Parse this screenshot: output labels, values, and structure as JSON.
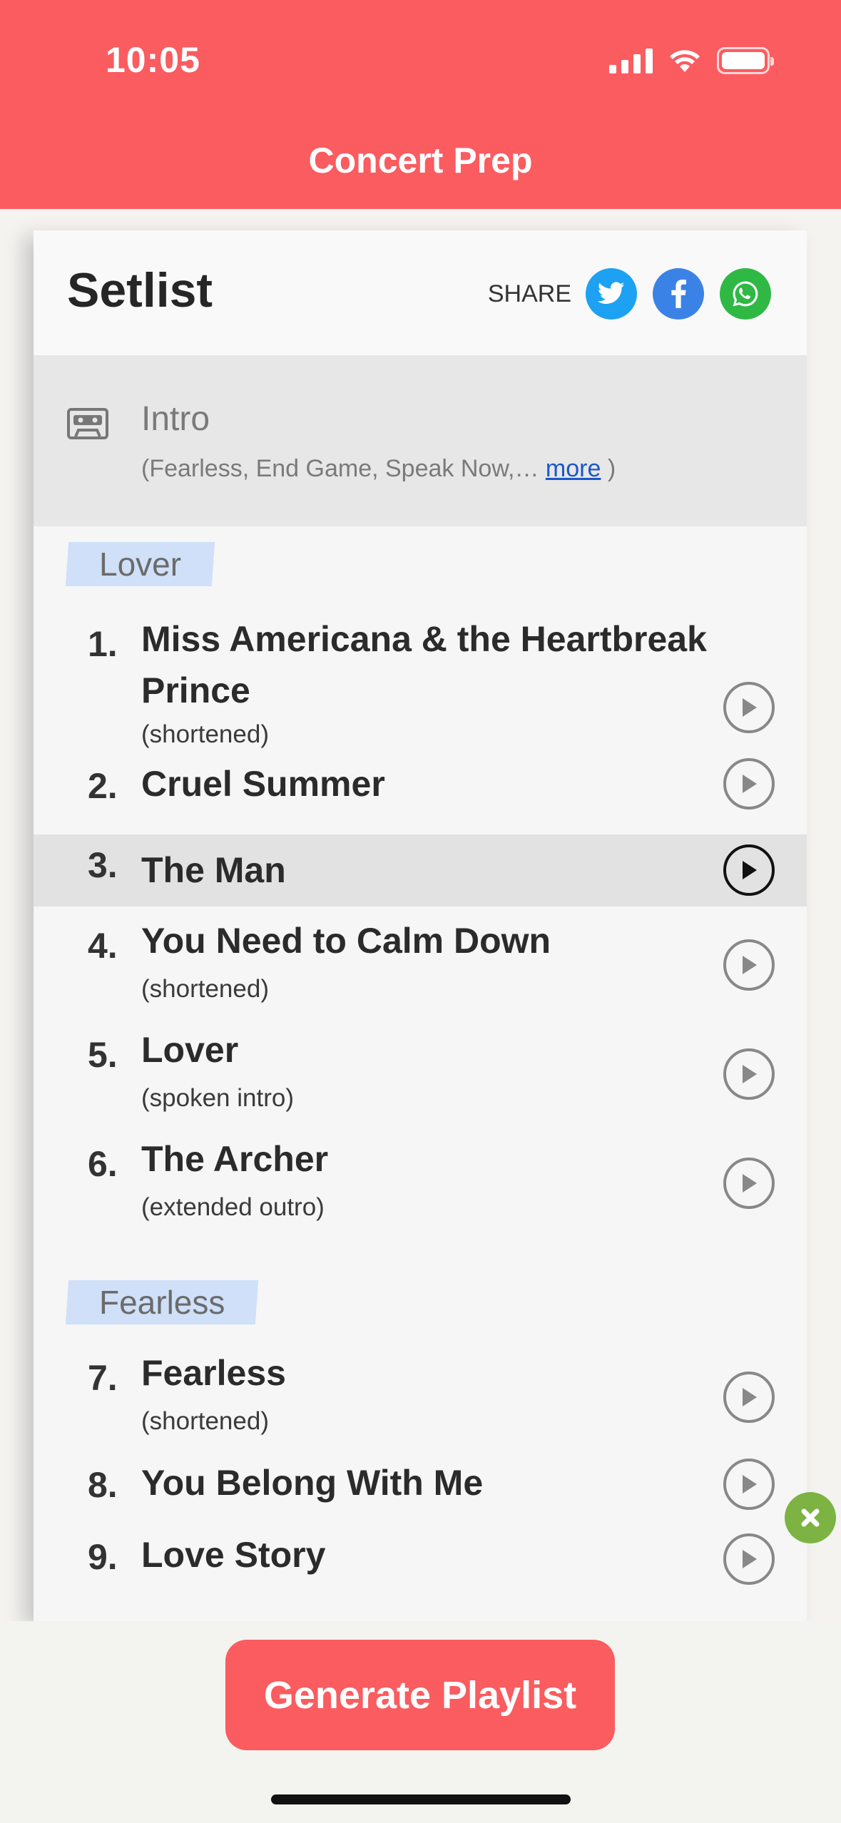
{
  "status": {
    "time": "10:05"
  },
  "header": {
    "title": "Concert Prep"
  },
  "card": {
    "title": "Setlist",
    "share_label": "SHARE",
    "share_icons": [
      "twitter-icon",
      "facebook-icon",
      "whatsapp-icon"
    ]
  },
  "intro": {
    "title": "Intro",
    "sub_prefix": "(Fearless, End Game, Speak Now,… ",
    "more": "more",
    "sub_suffix": " )"
  },
  "sections": [
    {
      "label": "Lover"
    },
    {
      "label": "Fearless"
    }
  ],
  "songs": [
    {
      "num": "1.",
      "name": "Miss Americana & the Heartbreak Prince",
      "note": "(shortened)"
    },
    {
      "num": "2.",
      "name": "Cruel Summer",
      "note": ""
    },
    {
      "num": "3.",
      "name": "The Man",
      "note": ""
    },
    {
      "num": "4.",
      "name": "You Need to Calm Down",
      "note": "(shortened)"
    },
    {
      "num": "5.",
      "name": "Lover",
      "note": "(spoken intro)"
    },
    {
      "num": "6.",
      "name": "The Archer",
      "note": "(extended outro)"
    },
    {
      "num": "7.",
      "name": "Fearless",
      "note": "(shortened)"
    },
    {
      "num": "8.",
      "name": "You Belong With Me",
      "note": ""
    },
    {
      "num": "9.",
      "name": "Love Story",
      "note": ""
    }
  ],
  "active_song": 3,
  "footer": {
    "button": "Generate Playlist"
  },
  "colors": {
    "brand": "#fa5c60",
    "twitter": "#1da1f2",
    "facebook": "#3b82e6",
    "whatsapp": "#2fb944",
    "fab": "#7cb342"
  }
}
